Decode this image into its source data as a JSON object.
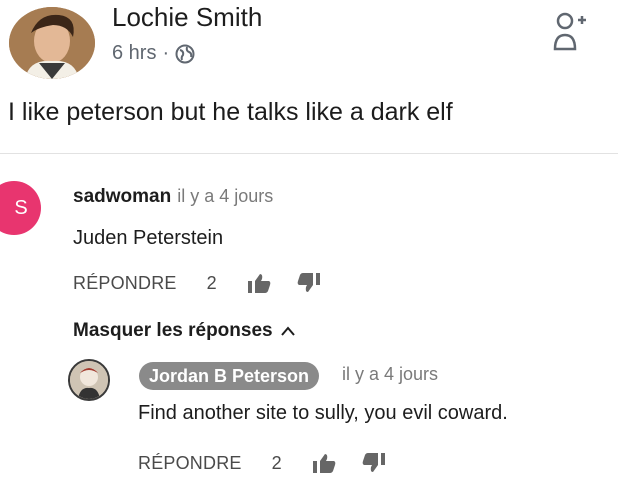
{
  "post": {
    "author": "Lochie Smith",
    "time": "6 hrs",
    "separator": "·",
    "text": "I like peterson but he talks like a dark elf"
  },
  "comment": {
    "avatar_letter": "S",
    "author": "sadwoman",
    "time": "il y a 4 jours",
    "text": "Juden Peterstein",
    "reply_label": "RÉPONDRE",
    "likes": "2",
    "hide_replies_label": "Masquer les réponses"
  },
  "reply": {
    "author": "Jordan B Peterson",
    "time": "il y a 4 jours",
    "text": "Find another site to sully, you evil coward.",
    "reply_label": "RÉPONDRE",
    "likes": "2"
  },
  "colors": {
    "avatar_s": "#e8356f",
    "badge": "#8a8a8a"
  }
}
